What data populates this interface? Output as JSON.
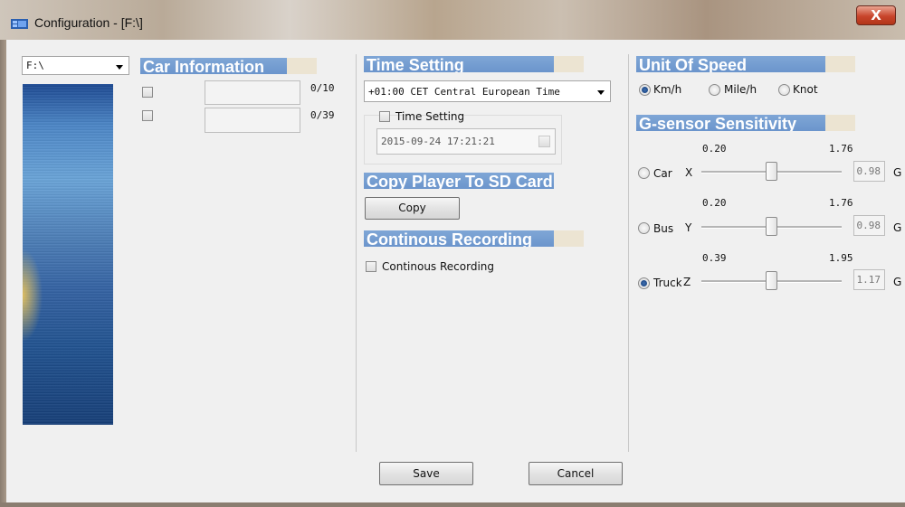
{
  "window": {
    "title": "Configuration - [F:\\]",
    "close_glyph": "X"
  },
  "drive_combo": {
    "value": "F:\\"
  },
  "car_information": {
    "header": "Car Information",
    "fields": [
      {
        "counter": "0/10"
      },
      {
        "counter": "0/39"
      }
    ]
  },
  "time_setting": {
    "header": "Time Setting",
    "timezone": "+01:00 CET Central European Time",
    "checkbox_label": "Time Setting",
    "datetime": "2015-09-24 17:21:21"
  },
  "copy_player": {
    "header": "Copy Player To SD Card",
    "button": "Copy"
  },
  "continuous_recording": {
    "header": "Continous Recording",
    "checkbox_label": "Continous Recording"
  },
  "unit_of_speed": {
    "header": "Unit Of Speed",
    "options": [
      "Km/h",
      "Mile/h",
      "Knot"
    ],
    "selected": "Km/h"
  },
  "g_sensor": {
    "header": "G-sensor Sensitivity",
    "presets": [
      {
        "label": "Car",
        "axis": "X",
        "min": "0.20",
        "max": "1.76",
        "value": "0.98",
        "unit": "G",
        "position_fraction": 0.5,
        "selected": false
      },
      {
        "label": "Bus",
        "axis": "Y",
        "min": "0.20",
        "max": "1.76",
        "value": "0.98",
        "unit": "G",
        "position_fraction": 0.5,
        "selected": false
      },
      {
        "label": "Truck",
        "axis": "Z",
        "min": "0.39",
        "max": "1.95",
        "value": "1.17",
        "unit": "G",
        "position_fraction": 0.5,
        "selected": true
      }
    ]
  },
  "footer": {
    "save": "Save",
    "cancel": "Cancel"
  },
  "colors": {
    "section_header": "#6b95cc",
    "close_button": "#c8452c",
    "dialog_background": "#f0f0f0"
  }
}
